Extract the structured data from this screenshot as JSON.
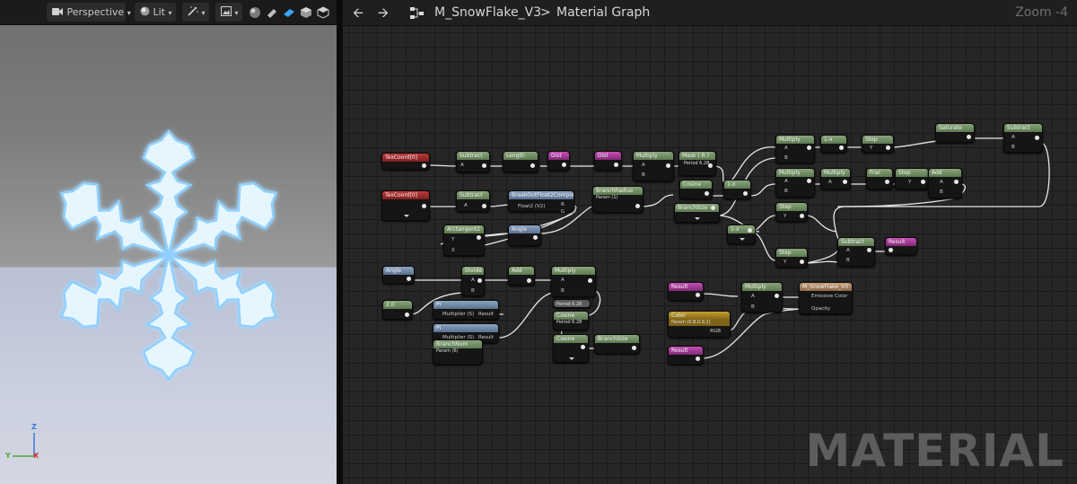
{
  "viewport": {
    "toolbar": {
      "perspective_label": "Perspective",
      "lit_label": "Lit"
    },
    "gizmo": {
      "z": "Z",
      "y": "Y",
      "x": "X"
    }
  },
  "header": {
    "asset_name": "M_SnowFlake_V3",
    "separator": ">",
    "graph_name": "Material Graph",
    "zoom": "Zoom -4"
  },
  "watermark": "MATERIAL",
  "nodes": {
    "texcoord1": {
      "title": "TexCoord[0]"
    },
    "subtract1": {
      "title": "Subtract",
      "pin_a": "A"
    },
    "length": {
      "title": "Length"
    },
    "dist1": {
      "title": "Dist"
    },
    "dist2": {
      "title": "Dist"
    },
    "multiply1": {
      "title": "Multiply",
      "pin_a": "A",
      "pin_b": "B"
    },
    "mask": {
      "title": "Mask ( R )",
      "sub": "Period 6.28"
    },
    "texcoord2": {
      "title": "TexCoord[0]"
    },
    "subtract2": {
      "title": "Subtract",
      "pin_a": "A"
    },
    "breakout": {
      "title": "BreakOutFloat2Components",
      "pin_in": "Float2 (V2)",
      "pin_r": "R",
      "pin_g": "G"
    },
    "branchradius": {
      "title": "BranchRadius",
      "sub": "Param (1)"
    },
    "arctangent": {
      "title": "Arctangent2",
      "pin_y": "Y",
      "pin_x": "X"
    },
    "angle1": {
      "title": "Angle"
    },
    "cosine1": {
      "title": "Cosine"
    },
    "oneminus1": {
      "title": "1-x"
    },
    "branchsize1": {
      "title": "BranchSize"
    },
    "multiply2": {
      "title": "Multiply",
      "pin_a": "A",
      "pin_b": "B"
    },
    "oneminus2": {
      "title": "1-x"
    },
    "step1": {
      "title": "Step",
      "pin_y": "Y"
    },
    "saturate": {
      "title": "Saturate"
    },
    "subtract3": {
      "title": "Subtract",
      "pin_a": "A",
      "pin_b": "B"
    },
    "multiply3": {
      "title": "Multiply",
      "pin_a": "A",
      "pin_b": "B"
    },
    "multiply4": {
      "title": "Multiply",
      "pin_a": "A"
    },
    "frac": {
      "title": "Frac"
    },
    "step2": {
      "title": "Step",
      "pin_y": "Y"
    },
    "add1": {
      "title": "Add",
      "pin_a": "A",
      "pin_b": "B"
    },
    "step3": {
      "title": "Step",
      "pin_y": "Y"
    },
    "oneminus3": {
      "title": "1-x"
    },
    "step4": {
      "title": "Step",
      "pin_y": "Y"
    },
    "subtract4": {
      "title": "Subtract",
      "pin_a": "A",
      "pin_b": "B"
    },
    "result1": {
      "title": "Result"
    },
    "angle2": {
      "title": "Angle"
    },
    "divide": {
      "title": "Divide",
      "pin_a": "A",
      "pin_b": "B"
    },
    "add2": {
      "title": "Add"
    },
    "multiply5": {
      "title": "Multiply",
      "pin_a": "A",
      "pin_b": "B"
    },
    "const2": {
      "title": "2.0"
    },
    "pi1": {
      "title": "Pi",
      "pin": "Multiplier (S)",
      "out": "Result"
    },
    "pi2": {
      "title": "Pi",
      "pin": "Multiplier (S)",
      "out": "Result"
    },
    "branchnum": {
      "title": "BranchNum",
      "sub": "Param (6)"
    },
    "period": {
      "title": "Period 6.28"
    },
    "cosine2": {
      "title": "Cosine",
      "sub": "Period 6.28"
    },
    "cosine3": {
      "title": "Cosine"
    },
    "branchsize2": {
      "title": "BranchSize"
    },
    "result2": {
      "title": "Result"
    },
    "multiply6": {
      "title": "Multiply",
      "pin_a": "A",
      "pin_b": "B"
    },
    "output": {
      "title": "M_SnowFlake_V3",
      "pin_emissive": "Emissive Color",
      "pin_opacity": "Opacity"
    },
    "color": {
      "title": "Color",
      "sub": "Param (0.8,0.9,1)",
      "out": "RGB"
    },
    "result3": {
      "title": "Result"
    }
  },
  "colors": {
    "snowflake": "#e6f6ff",
    "glow": "#5fb8ff",
    "wire": "#e8e8e8",
    "graph_bg": "#262626"
  }
}
